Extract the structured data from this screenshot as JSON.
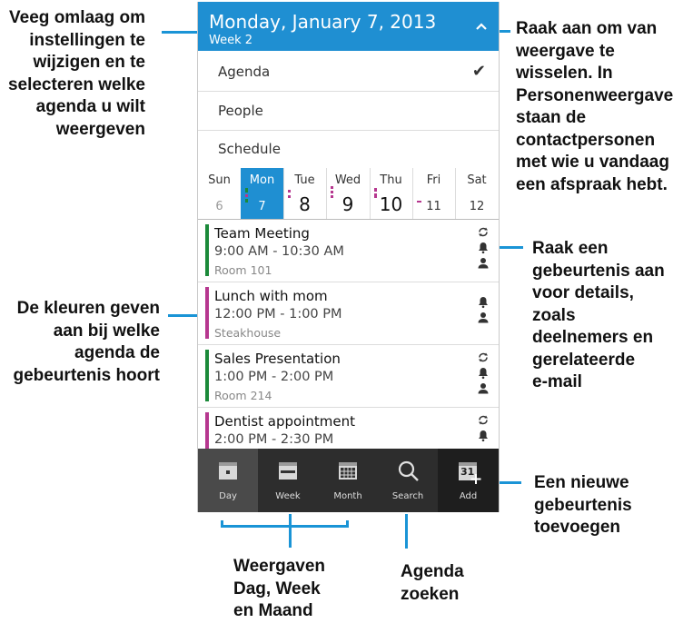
{
  "header": {
    "date": "Monday, January 7, 2013",
    "week": "Week 2"
  },
  "menu": [
    {
      "label": "Agenda",
      "checked": true
    },
    {
      "label": "People",
      "checked": false
    },
    {
      "label": "Schedule",
      "checked": false
    }
  ],
  "check_glyph": "✔",
  "days": [
    {
      "name": "Sun",
      "num": "6",
      "selected": false
    },
    {
      "name": "Mon",
      "num": "7",
      "selected": true
    },
    {
      "name": "Tue",
      "num": "8",
      "selected": false
    },
    {
      "name": "Wed",
      "num": "9",
      "selected": false
    },
    {
      "name": "Thu",
      "num": "10",
      "selected": false
    },
    {
      "name": "Fri",
      "num": "11",
      "selected": false
    },
    {
      "name": "Sat",
      "num": "12",
      "selected": false
    }
  ],
  "events": [
    {
      "title": "Team Meeting",
      "time": "9:00 AM - 10:30 AM",
      "location": "Room 101",
      "color": "#1b8a3a",
      "icons": [
        "sync-icon",
        "bell-icon",
        "person-icon"
      ]
    },
    {
      "title": "Lunch with mom",
      "time": "12:00 PM - 1:00 PM",
      "location": "Steakhouse",
      "color": "#b6378f",
      "icons": [
        "bell-icon",
        "person-icon"
      ]
    },
    {
      "title": "Sales Presentation",
      "time": "1:00 PM - 2:00 PM",
      "location": "Room 214",
      "color": "#1b8a3a",
      "icons": [
        "sync-icon",
        "bell-icon",
        "person-icon"
      ]
    },
    {
      "title": "Dentist appointment",
      "time": "2:00 PM - 2:30 PM",
      "location": "",
      "color": "#b6378f",
      "icons": [
        "sync-icon",
        "bell-icon",
        "person-icon"
      ]
    }
  ],
  "toolbar": {
    "day": "Day",
    "week": "Week",
    "month": "Month",
    "search": "Search",
    "add": "Add",
    "add_icon_num": "31"
  },
  "annotations": {
    "swipe": [
      "Veeg omlaag om",
      "instellingen te",
      "wijzigen en te",
      "selecteren welke",
      "agenda u wilt",
      "weergeven"
    ],
    "switch_view": [
      "Raak aan om van",
      "weergave te",
      "wisselen. In",
      "Personenweergave",
      "staan de",
      "contactpersonen",
      "met wie u vandaag",
      "een afspraak hebt."
    ],
    "colors": [
      "De kleuren geven",
      "aan bij welke",
      "agenda de",
      "gebeurtenis hoort"
    ],
    "event_details": [
      "Raak een",
      "gebeurtenis aan",
      "voor details,",
      "zoals",
      "deelnemers en",
      "gerelateerde",
      "e-mail"
    ],
    "new_event": [
      "Een nieuwe",
      "gebeurtenis",
      "toevoegen"
    ],
    "views": [
      "Weergaven",
      "Dag, Week",
      "en Maand"
    ],
    "search": [
      "Agenda",
      "zoeken"
    ]
  },
  "colors": {
    "accent": "#1f8fd2",
    "leader": "#1a94d6",
    "green": "#1b8a3a",
    "magenta": "#b6378f",
    "toolbar": "#2d2d2d"
  }
}
